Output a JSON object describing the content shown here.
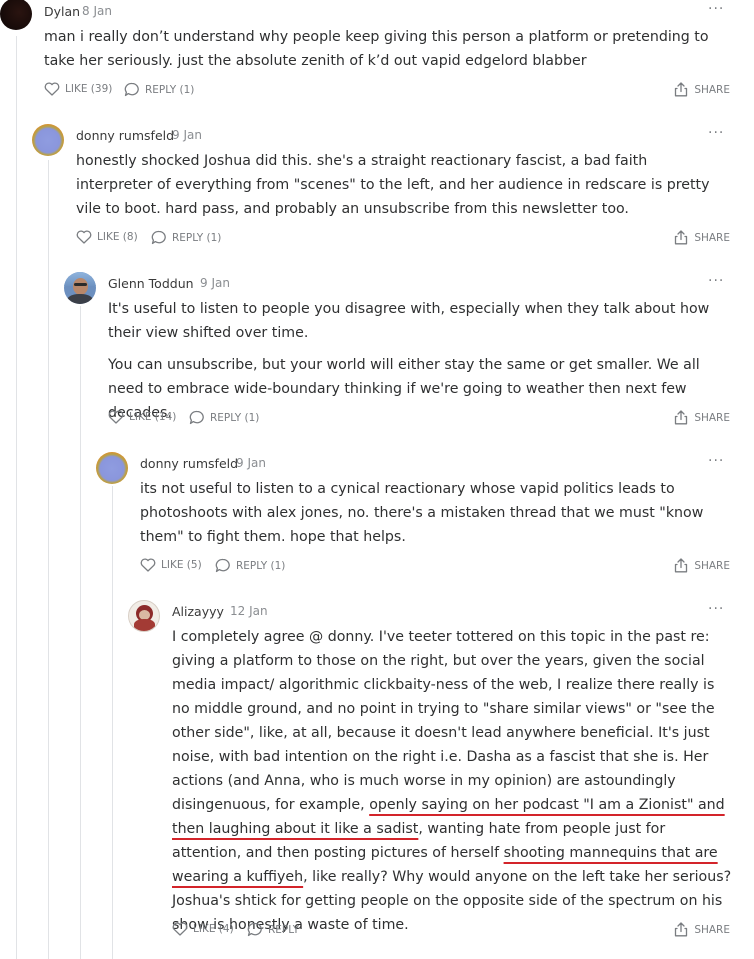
{
  "comments": [
    {
      "author": "Dylan",
      "date": "8 Jan",
      "paragraphs": [
        "man i really don’t understand why people keep giving this person a platform or pretending to take her seriously. just the absolute zenith of k’d out vapid edgelord blabber"
      ],
      "like_label": "LIKE (39)",
      "reply_label": "REPLY (1)",
      "share_label": "SHARE"
    },
    {
      "author": "donny rumsfeld",
      "date": "9 Jan",
      "paragraphs": [
        "honestly shocked Joshua did this. she's a straight reactionary fascist, a bad faith interpreter of everything from \"scenes\" to the left, and her audience in redscare is pretty vile to boot. hard pass, and probably an unsubscribe from this newsletter too."
      ],
      "like_label": "LIKE (8)",
      "reply_label": "REPLY (1)",
      "share_label": "SHARE"
    },
    {
      "author": "Glenn Toddun",
      "date": "9 Jan",
      "paragraphs": [
        "It's useful to listen to people you disagree with, especially when they talk about how their view shifted over time.",
        "You can unsubscribe, but your world will either stay the same or get smaller. We all need to embrace wide-boundary thinking if we're going to weather then next few decades."
      ],
      "like_label": "LIKE (14)",
      "reply_label": "REPLY (1)",
      "share_label": "SHARE"
    },
    {
      "author": "donny rumsfeld",
      "date": "9 Jan",
      "paragraphs": [
        "its not useful to listen to a cynical reactionary whose vapid politics leads to photoshoots with alex jones, no. there's a mistaken thread that we must \"know them\" to fight them. hope that helps."
      ],
      "like_label": "LIKE (5)",
      "reply_label": "REPLY (1)",
      "share_label": "SHARE"
    },
    {
      "author": "Alizayyy",
      "date": "12 Jan",
      "segments": {
        "s1": "I completely agree @ donny. I've teeter tottered on this topic in the past re: giving a platform to those on the right, but over the years, given the social media impact/ algorithmic clickbaity-ness of the web, I realize there really is no middle ground, and no point in trying to \"share similar views\" or \"see the other side\", like, at all, because it doesn't lead anywhere beneficial. It's just noise, with bad intention on the right i.e. Dasha as a fascist that she is. Her actions (and Anna, who is much worse in my opinion) are astoundingly disingenuous, for example, ",
        "u1": "openly saying on her podcast \"I am a Zionist\" and then laughing about it like a sadist",
        "s2": ", wanting hate from people just for attention, and then posting pictures of herself ",
        "u2": "shooting mannequins that are wearing a kuffiyeh",
        "s3": ", like really? Why would anyone on the left take her serious? Joshua's shtick for getting people on the opposite side of the spectrum on his show is honestly a waste of time."
      },
      "like_label": "LIKE (4)",
      "reply_label": "REPLY",
      "share_label": "SHARE"
    }
  ],
  "more_glyph": "···",
  "icons": [
    "heart-icon",
    "speech-bubble-icon",
    "share-icon",
    "more-options-icon"
  ],
  "colors": {
    "underline": "#d3242a",
    "muted": "#7a7d81",
    "rule": "#e1e3e6"
  }
}
